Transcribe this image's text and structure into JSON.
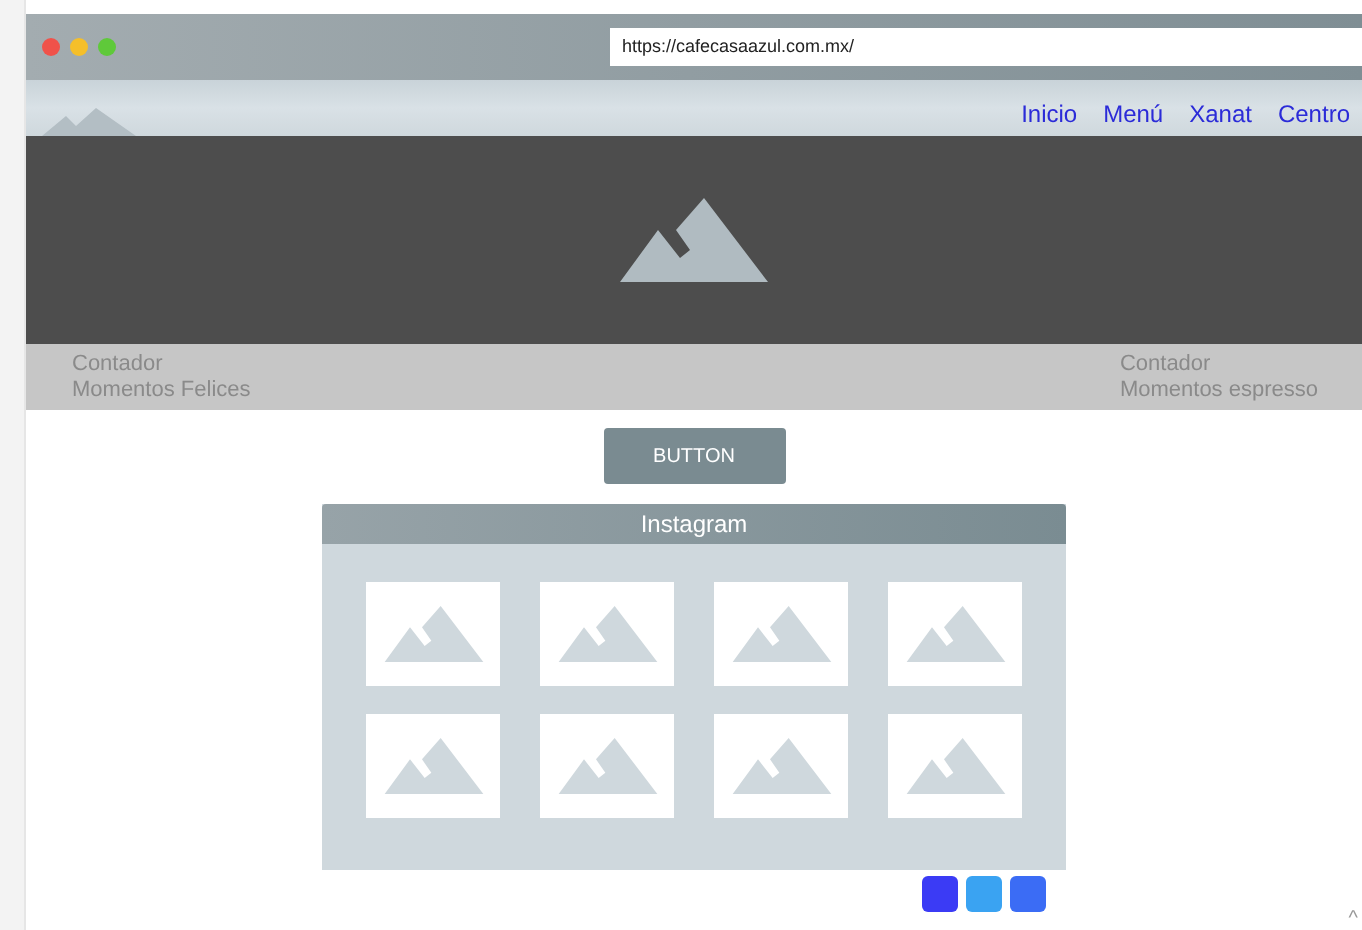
{
  "browser": {
    "url": "https://cafecasaazul.com.mx/"
  },
  "nav": {
    "items": [
      {
        "label": "Inicio"
      },
      {
        "label": "Menú"
      },
      {
        "label": "Xanat"
      },
      {
        "label": "Centro"
      }
    ]
  },
  "counters": [
    {
      "title": "Contador",
      "subtitle": "Momentos Felices"
    },
    {
      "title": "Contador",
      "subtitle": "Momentos espresso"
    }
  ],
  "button": {
    "label": "BUTTON"
  },
  "instagram": {
    "title": "Instagram",
    "tiles": [
      {
        "kind": "placeholder"
      },
      {
        "kind": "placeholder"
      },
      {
        "kind": "placeholder"
      },
      {
        "kind": "placeholder"
      },
      {
        "kind": "placeholder"
      },
      {
        "kind": "placeholder"
      },
      {
        "kind": "placeholder"
      },
      {
        "kind": "placeholder"
      }
    ]
  },
  "social_buttons": [
    {
      "color": "#3b3bf5"
    },
    {
      "color": "#3aa3f2"
    },
    {
      "color": "#3b6cf5"
    }
  ],
  "scroll_top": "^"
}
